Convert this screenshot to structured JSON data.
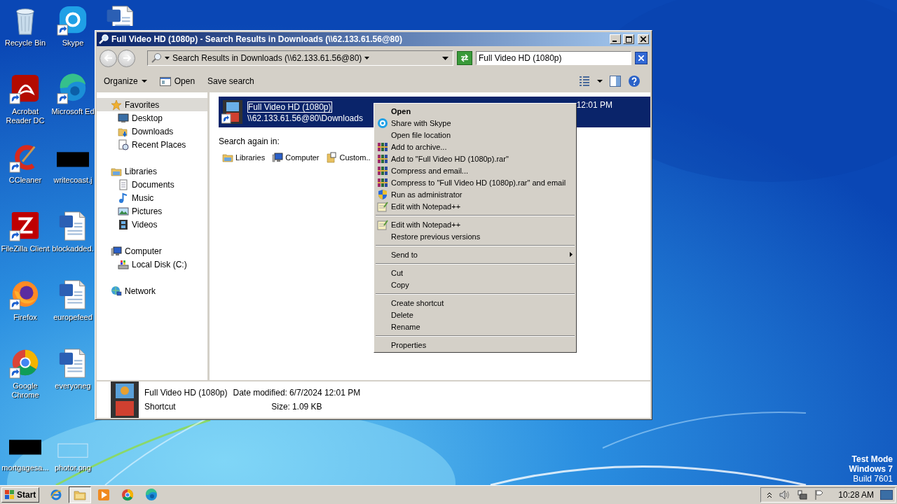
{
  "desktop": {
    "icons": [
      {
        "kind": "recycle",
        "label": "Recycle Bin",
        "shortcut": false
      },
      {
        "kind": "acrobat",
        "label": "Acrobat Reader DC",
        "shortcut": true
      },
      {
        "kind": "ccleaner",
        "label": "CCleaner",
        "shortcut": true
      },
      {
        "kind": "filezilla",
        "label": "FileZilla Client",
        "shortcut": true
      },
      {
        "kind": "firefox",
        "label": "Firefox",
        "shortcut": true
      },
      {
        "kind": "chrome",
        "label": "Google Chrome",
        "shortcut": true
      },
      {
        "kind": "image_dark",
        "label": "mortgagesa...",
        "shortcut": false
      },
      {
        "kind": "skype",
        "label": "Skype",
        "shortcut": true
      },
      {
        "kind": "edge",
        "label": "Microsoft Ed",
        "shortcut": true
      },
      {
        "kind": "image_dark",
        "label": "writecoast.j",
        "shortcut": false
      },
      {
        "kind": "word",
        "label": "blockadded.",
        "shortcut": false
      },
      {
        "kind": "word",
        "label": "europefeed",
        "shortcut": false
      },
      {
        "kind": "word",
        "label": "everyoneg",
        "shortcut": false
      },
      {
        "kind": "image_light",
        "label": "photor.png",
        "shortcut": false
      },
      {
        "kind": "word",
        "shortcut": false
      }
    ],
    "os_notice": [
      {
        "text": "Test Mode",
        "bold": true
      },
      {
        "text": "Windows 7",
        "bold": true
      },
      {
        "text": "Build 7601",
        "bold": false
      }
    ]
  },
  "window": {
    "title": "Full Video HD (1080p) - Search Results in Downloads (\\\\62.133.61.56@80)",
    "address": "Search Results in Downloads (\\\\62.133.61.56@80)",
    "search": {
      "value": "Full Video HD (1080p)"
    },
    "toolbar": [
      {
        "kind": "menu",
        "label": "Organize"
      },
      {
        "kind": "open",
        "label": "Open"
      },
      {
        "kind": "plain",
        "label": "Save search"
      }
    ],
    "nav": [
      {
        "kind": "favorites",
        "label": "Favorites",
        "selected": true,
        "children": [
          {
            "kind": "desktop",
            "label": "Desktop",
            "selected": false
          },
          {
            "kind": "downloads",
            "label": "Downloads",
            "selected": false
          },
          {
            "kind": "recent",
            "label": "Recent Places",
            "selected": false
          }
        ]
      },
      {
        "kind": "libraries",
        "label": "Libraries",
        "selected": false,
        "children": [
          {
            "kind": "documents",
            "label": "Documents",
            "selected": false
          },
          {
            "kind": "music",
            "label": "Music",
            "selected": false
          },
          {
            "kind": "pictures",
            "label": "Pictures",
            "selected": false
          },
          {
            "kind": "videos",
            "label": "Videos",
            "selected": false
          }
        ]
      },
      {
        "kind": "computer",
        "label": "Computer",
        "selected": false,
        "children": [
          {
            "kind": "disk",
            "label": "Local Disk (C:)",
            "selected": false
          }
        ]
      },
      {
        "kind": "network",
        "label": "Network",
        "selected": false
      }
    ],
    "results": [
      {
        "name": "Full Video HD (1080p)",
        "path": "\\\\62.133.61.56@80\\Downloads",
        "modified": "12:01 PM",
        "selected": true
      }
    ],
    "search_again": {
      "label": "Search again in:",
      "locations": [
        {
          "kind": "libraries",
          "label": "Libraries"
        },
        {
          "kind": "computer",
          "label": "Computer"
        },
        {
          "kind": "custom",
          "label": "Custom.."
        }
      ]
    },
    "details": {
      "name": "Full Video HD (1080p)",
      "type": "Shortcut",
      "fields": [
        {
          "label": "Date modified:",
          "value": "6/7/2024 12:01 PM"
        },
        {
          "label": "Size:",
          "value": "1.09 KB"
        }
      ]
    }
  },
  "context_menu": {
    "items": [
      {
        "kind": "plain",
        "label": "Open",
        "default": true,
        "submenu": false
      },
      {
        "kind": "skype",
        "label": "Share with Skype",
        "default": false,
        "submenu": false
      },
      {
        "kind": "plain",
        "label": "Open file location",
        "default": false,
        "submenu": false
      },
      {
        "kind": "rar",
        "label": "Add to archive...",
        "default": false,
        "submenu": false
      },
      {
        "kind": "rar",
        "label": "Add to \"Full Video HD (1080p).rar\"",
        "default": false,
        "submenu": false
      },
      {
        "kind": "rar",
        "label": "Compress and email...",
        "default": false,
        "submenu": false
      },
      {
        "kind": "rar",
        "label": "Compress to \"Full Video HD (1080p).rar\" and email",
        "default": false,
        "submenu": false
      },
      {
        "kind": "shield",
        "label": "Run as administrator",
        "default": false,
        "submenu": false
      },
      {
        "kind": "notepad",
        "label": "Edit with Notepad++",
        "default": false,
        "submenu": false
      },
      {
        "kind": "separator"
      },
      {
        "kind": "notepad",
        "label": "Edit with Notepad++",
        "default": false,
        "submenu": false
      },
      {
        "kind": "plain",
        "label": "Restore previous versions",
        "default": false,
        "submenu": false
      },
      {
        "kind": "separator"
      },
      {
        "kind": "plain",
        "label": "Send to",
        "default": false,
        "submenu": true
      },
      {
        "kind": "separator"
      },
      {
        "kind": "plain",
        "label": "Cut",
        "default": false,
        "submenu": false
      },
      {
        "kind": "plain",
        "label": "Copy",
        "default": false,
        "submenu": false
      },
      {
        "kind": "separator"
      },
      {
        "kind": "plain",
        "label": "Create shortcut",
        "default": false,
        "submenu": false
      },
      {
        "kind": "plain",
        "label": "Delete",
        "default": false,
        "submenu": false
      },
      {
        "kind": "plain",
        "label": "Rename",
        "default": false,
        "submenu": false
      },
      {
        "kind": "separator"
      },
      {
        "kind": "plain",
        "label": "Properties",
        "default": false,
        "submenu": false
      }
    ]
  },
  "taskbar": {
    "start": "Start",
    "apps": [
      {
        "kind": "ie",
        "selected": false
      },
      {
        "kind": "explorer",
        "selected": true
      },
      {
        "kind": "media",
        "selected": false
      },
      {
        "kind": "chrome",
        "selected": false
      },
      {
        "kind": "edge",
        "selected": false
      }
    ],
    "clock": "10:28 AM"
  }
}
